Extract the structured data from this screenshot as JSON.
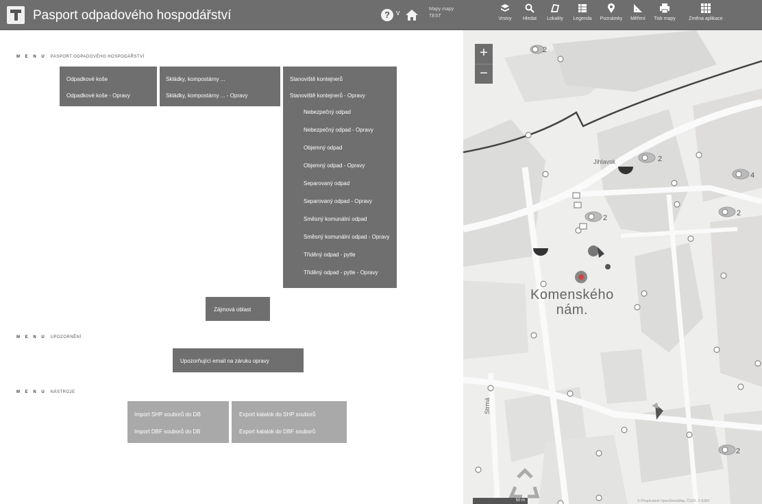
{
  "header": {
    "title": "Pasport odpadového hospodářství",
    "help": "?",
    "help_caret": "v",
    "map_name": [
      "Mapy mapy",
      "TEST"
    ],
    "tools": [
      {
        "label": "Vrstvy",
        "icon": "layers-icon"
      },
      {
        "label": "Hledat",
        "icon": "search-icon"
      },
      {
        "label": "Lokality",
        "icon": "locality-icon"
      },
      {
        "label": "Legenda",
        "icon": "legend-icon"
      },
      {
        "label": "Poznámky",
        "icon": "pin-icon"
      },
      {
        "label": "Měření",
        "icon": "measure-icon"
      },
      {
        "label": "Tisk mapy",
        "icon": "print-icon"
      },
      {
        "label": "Změna aplikace",
        "icon": "apps-grid-icon"
      }
    ]
  },
  "menus": [
    {
      "prefix": "M E N U",
      "title": "PASPORT ODPADOVÉHO HOSPODÁŘSTVÍ"
    },
    {
      "prefix": "M E N U",
      "title": "UPOZORNĚNÍ"
    },
    {
      "prefix": "M E N U",
      "title": "NÁSTROJE"
    }
  ],
  "pasport": {
    "col1": [
      "Odpadkové koše",
      "Odpadkové koše - Opravy"
    ],
    "col2": [
      "Skládky, kompostárny ...",
      "Skládky, kompostárny ... - Opravy"
    ],
    "col3": [
      {
        "label": "Stanoviště kontejnerů",
        "sub": false
      },
      {
        "label": "Stanoviště kontejnerů - Opravy",
        "sub": false
      },
      {
        "label": "Nebezpečný odpad",
        "sub": true
      },
      {
        "label": "Nebezpečný odpad - Opravy",
        "sub": true
      },
      {
        "label": "Objemný odpad",
        "sub": true
      },
      {
        "label": "Objemný odpad - Opravy",
        "sub": true
      },
      {
        "label": "Separovaný odpad",
        "sub": true
      },
      {
        "label": "Separovaný odpad - Opravy",
        "sub": true
      },
      {
        "label": "Směsný komunální odpad",
        "sub": true
      },
      {
        "label": "Směsný komunální odpad - Opravy",
        "sub": true
      },
      {
        "label": "Tříděný odpad - pytle",
        "sub": true
      },
      {
        "label": "Tříděný odpad - pytle - Opravy",
        "sub": true
      }
    ],
    "zajmova": "Zájmová oblast"
  },
  "upozorneni": {
    "button": "Upozorňující email na záruku opravy"
  },
  "nastroje": {
    "col1": [
      "Import SHP souborů do DB",
      "Import DBF souborů do DB"
    ],
    "col2": [
      "Export katalok do SHP souborů",
      "Export katalok do DBF souborů"
    ]
  },
  "map": {
    "zoom_in": "+",
    "zoom_out": "−",
    "place": [
      "Komenského",
      "nám."
    ],
    "street_jihlavska": "Jihlavsk",
    "street_strma": "Strmá",
    "clusters": [
      "2",
      "2",
      "4",
      "2",
      "2",
      "2"
    ],
    "scale": "50 m",
    "attribution": "© Přispěvatelé OpenStreetMap, ČÚZK, © ESRI"
  },
  "colors": {
    "header_bg": "#6e6e6e",
    "menu_dark": "#6f6f6f",
    "menu_light": "#a9a9a9"
  }
}
